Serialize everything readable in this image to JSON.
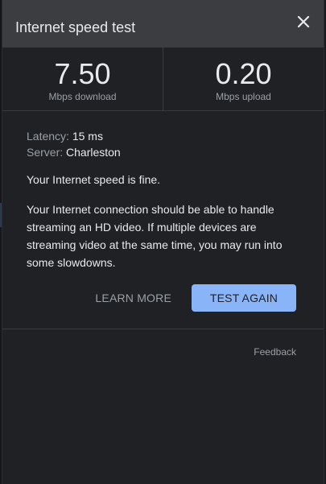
{
  "dialog": {
    "title": "Internet speed test",
    "close_icon": "close-icon"
  },
  "stats": {
    "download": {
      "value": "7.50",
      "label": "Mbps download"
    },
    "upload": {
      "value": "0.20",
      "label": "Mbps upload"
    }
  },
  "details": {
    "latency_label": "Latency:",
    "latency_value": "15 ms",
    "server_label": "Server:",
    "server_value": "Charleston"
  },
  "result": {
    "summary": "Your Internet speed is fine.",
    "description": "Your Internet connection should be able to handle streaming an HD video. If multiple devices are streaming video at the same time, you may run into some slowdowns."
  },
  "actions": {
    "learn_more": "LEARN MORE",
    "test_again": "TEST AGAIN"
  },
  "footer": {
    "feedback": "Feedback"
  },
  "colors": {
    "panel_bg": "#202124",
    "header_bg": "#3c3d40",
    "accent_button": "#8ab4f8",
    "primary_text": "#e8eaed",
    "secondary_text": "#9aa0a6"
  }
}
